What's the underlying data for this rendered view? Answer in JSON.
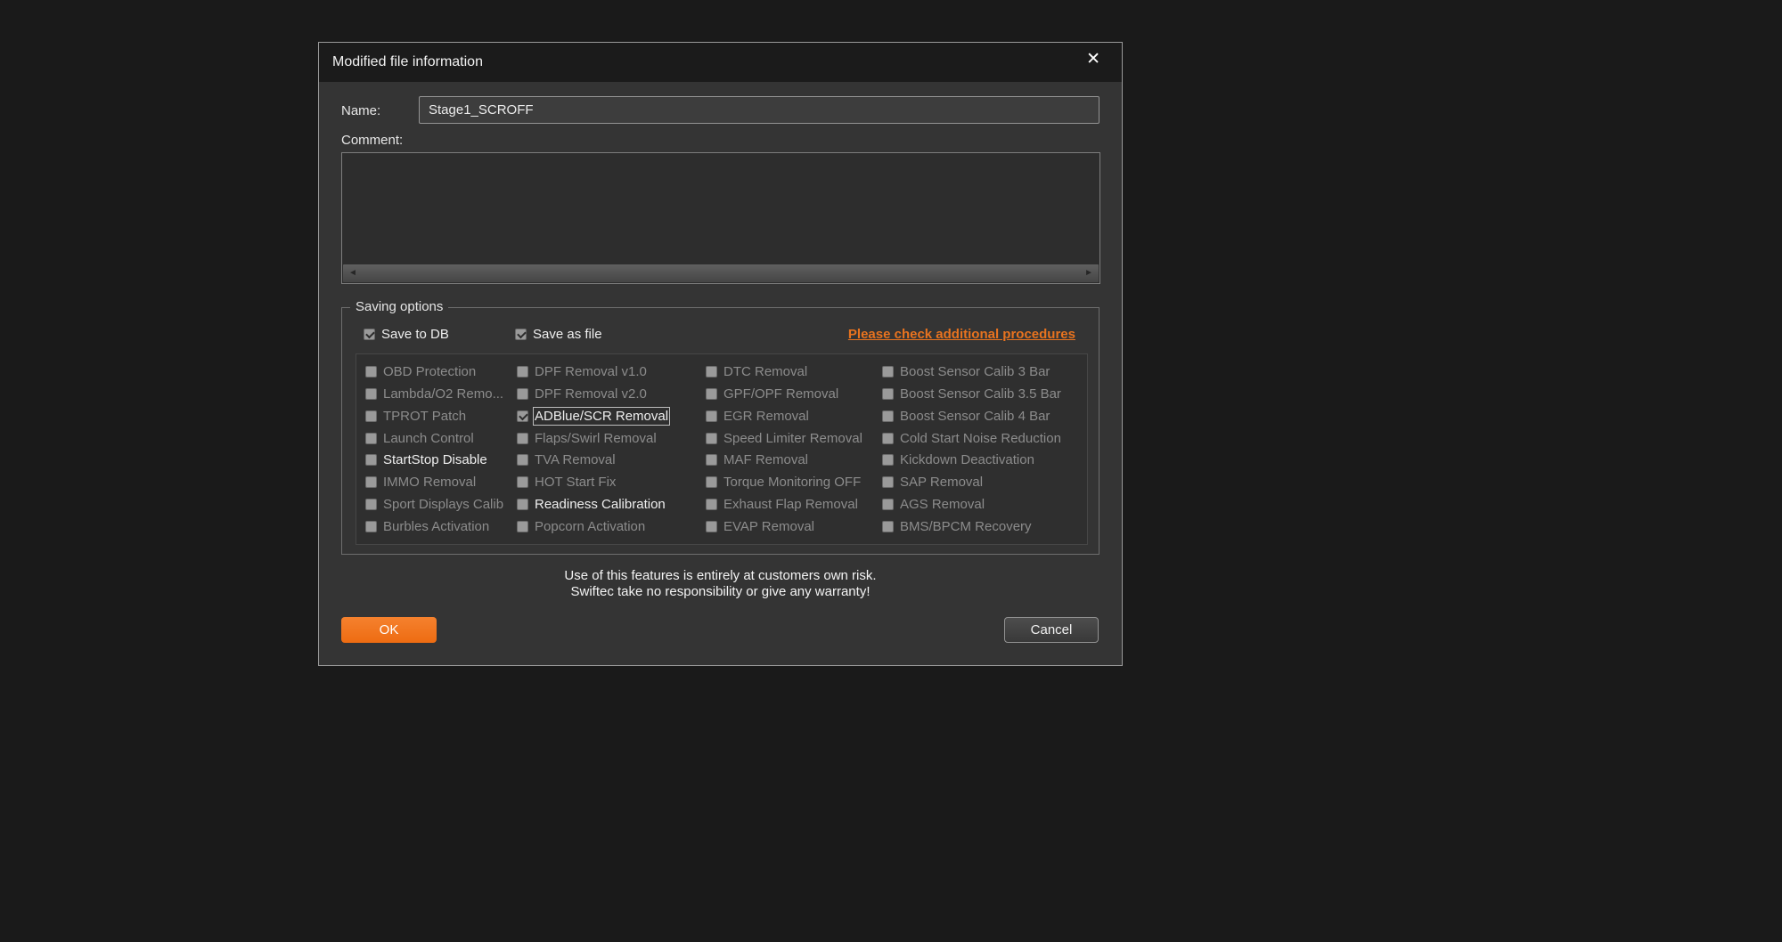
{
  "colors": {
    "accent": "#ee6c12",
    "link": "#e8731f"
  },
  "dialog": {
    "title": "Modified file information",
    "close_icon": "✕",
    "fields": {
      "name_label": "Name:",
      "name_value": "Stage1_SCROFF",
      "comment_label": "Comment:",
      "comment_value": ""
    },
    "scrollbar": {
      "left_arrow": "◄",
      "right_arrow": "►"
    },
    "saving_options": {
      "legend": "Saving options",
      "save_to_db": {
        "label": "Save to DB",
        "checked": true
      },
      "save_as_file": {
        "label": "Save as file",
        "checked": true
      },
      "procedures_link": "Please check additional procedures"
    },
    "options_grid": {
      "columns": [
        [
          {
            "label": "OBD Protection",
            "checked": false,
            "enabled": false
          },
          {
            "label": "Lambda/O2 Remo...",
            "checked": false,
            "enabled": false
          },
          {
            "label": "TPROT Patch",
            "checked": false,
            "enabled": false
          },
          {
            "label": "Launch Control",
            "checked": false,
            "enabled": false
          },
          {
            "label": "StartStop Disable",
            "checked": false,
            "enabled": true
          },
          {
            "label": "IMMO Removal",
            "checked": false,
            "enabled": false
          },
          {
            "label": "Sport Displays Calib",
            "checked": false,
            "enabled": false
          },
          {
            "label": "Burbles Activation",
            "checked": false,
            "enabled": false
          }
        ],
        [
          {
            "label": "DPF Removal v1.0",
            "checked": false,
            "enabled": false
          },
          {
            "label": "DPF Removal v2.0",
            "checked": false,
            "enabled": false
          },
          {
            "label": "ADBlue/SCR Removal",
            "checked": true,
            "enabled": true,
            "focused": true
          },
          {
            "label": "Flaps/Swirl Removal",
            "checked": false,
            "enabled": false
          },
          {
            "label": "TVA Removal",
            "checked": false,
            "enabled": false
          },
          {
            "label": "HOT Start Fix",
            "checked": false,
            "enabled": false
          },
          {
            "label": "Readiness Calibration",
            "checked": false,
            "enabled": true
          },
          {
            "label": "Popcorn Activation",
            "checked": false,
            "enabled": false
          }
        ],
        [
          {
            "label": "DTC Removal",
            "checked": false,
            "enabled": false
          },
          {
            "label": "GPF/OPF Removal",
            "checked": false,
            "enabled": false
          },
          {
            "label": "EGR Removal",
            "checked": false,
            "enabled": false
          },
          {
            "label": "Speed Limiter Removal",
            "checked": false,
            "enabled": false
          },
          {
            "label": "MAF Removal",
            "checked": false,
            "enabled": false
          },
          {
            "label": "Torque Monitoring OFF",
            "checked": false,
            "enabled": false
          },
          {
            "label": "Exhaust Flap Removal",
            "checked": false,
            "enabled": false
          },
          {
            "label": "EVAP Removal",
            "checked": false,
            "enabled": false
          }
        ],
        [
          {
            "label": "Boost Sensor Calib 3 Bar",
            "checked": false,
            "enabled": false
          },
          {
            "label": "Boost Sensor Calib 3.5 Bar",
            "checked": false,
            "enabled": false
          },
          {
            "label": "Boost Sensor Calib 4 Bar",
            "checked": false,
            "enabled": false
          },
          {
            "label": "Cold Start Noise Reduction",
            "checked": false,
            "enabled": false
          },
          {
            "label": "Kickdown Deactivation",
            "checked": false,
            "enabled": false
          },
          {
            "label": "SAP Removal",
            "checked": false,
            "enabled": false
          },
          {
            "label": "AGS Removal",
            "checked": false,
            "enabled": false
          },
          {
            "label": "BMS/BPCM Recovery",
            "checked": false,
            "enabled": false
          }
        ]
      ]
    },
    "warning": {
      "line1": "Use of this features is entirely at customers own risk.",
      "line2": "Swiftec take no responsibility or give any warranty!"
    },
    "buttons": {
      "ok": "OK",
      "cancel": "Cancel"
    }
  }
}
